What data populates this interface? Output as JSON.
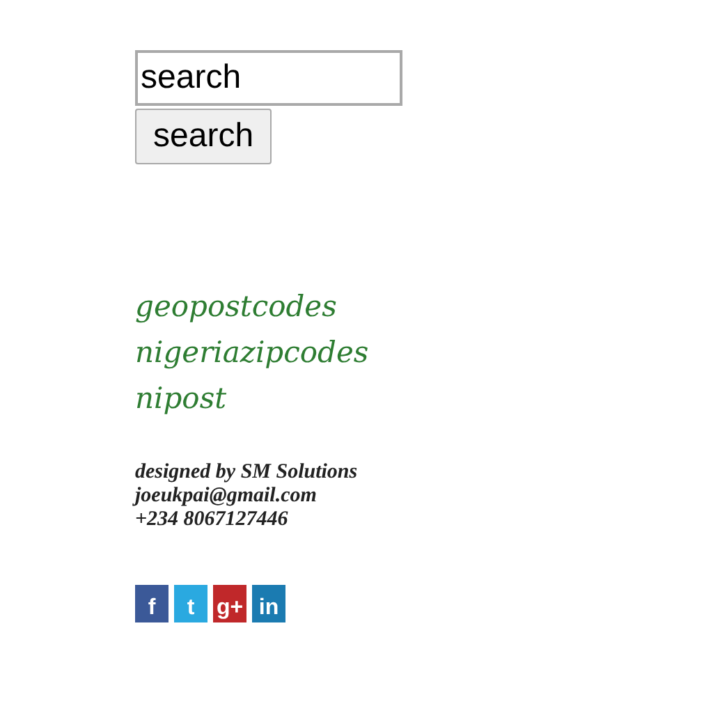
{
  "search": {
    "value": "search",
    "button": "search"
  },
  "links": [
    "geopostcodes",
    "nigeriazipcodes",
    "nipost"
  ],
  "credits": [
    "designed by SM Solutions",
    "joeukpai@gmail.com",
    "+234 8067127446"
  ],
  "social": [
    {
      "kind": "facebook",
      "glyph": "f"
    },
    {
      "kind": "twitter",
      "glyph": "t"
    },
    {
      "kind": "googleplus",
      "glyph": "g+"
    },
    {
      "kind": "linkedin",
      "glyph": "in"
    }
  ]
}
